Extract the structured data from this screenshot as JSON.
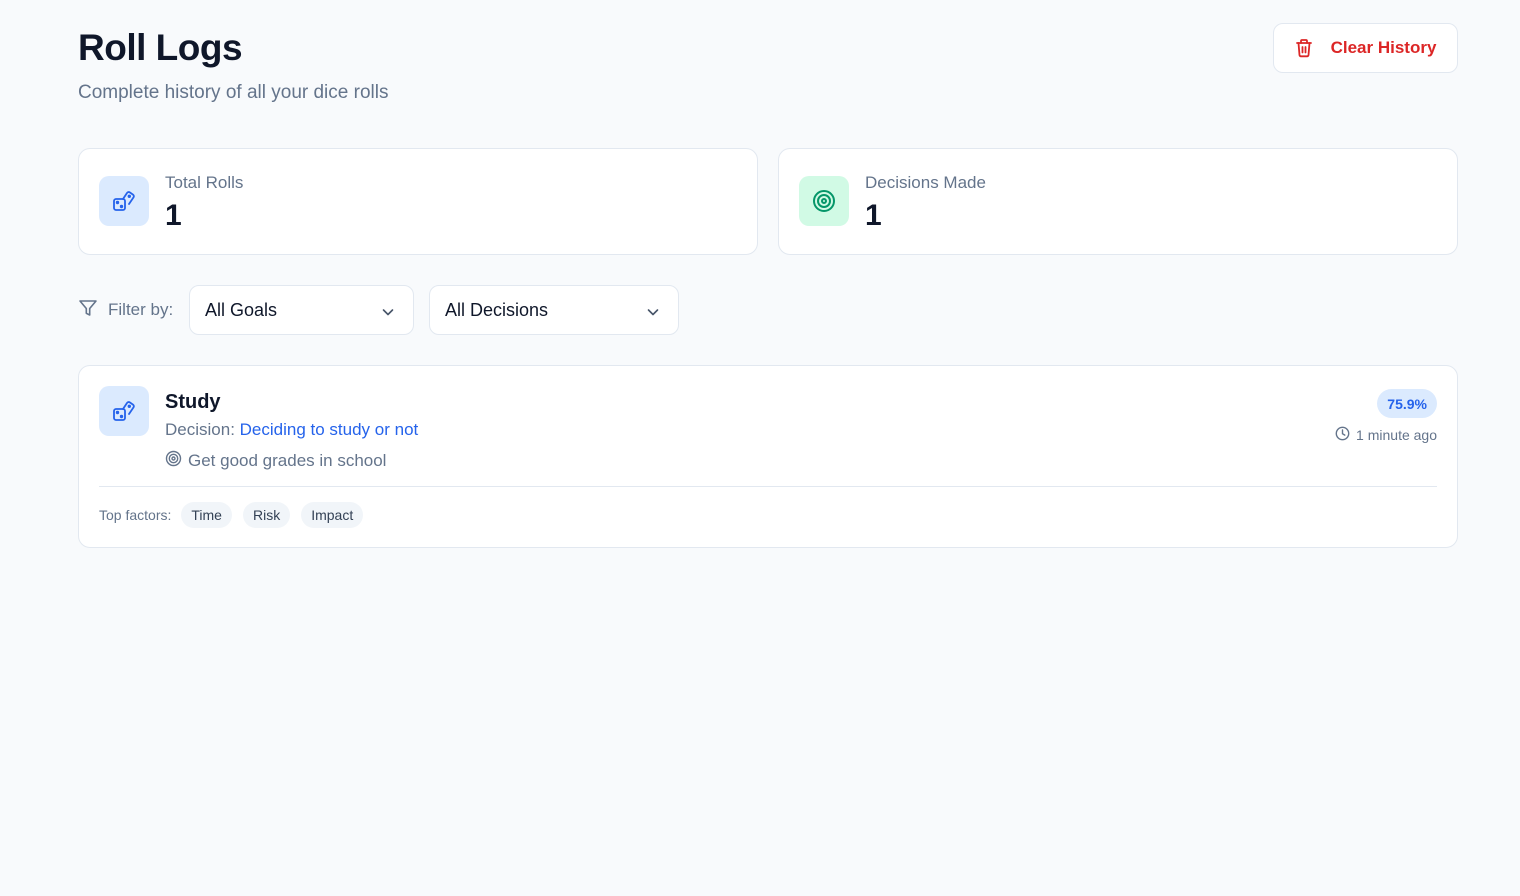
{
  "header": {
    "title": "Roll Logs",
    "subtitle": "Complete history of all your dice rolls",
    "clear_label": "Clear History"
  },
  "stats": [
    {
      "label": "Total Rolls",
      "value": "1",
      "icon": "dice-icon"
    },
    {
      "label": "Decisions Made",
      "value": "1",
      "icon": "target-icon"
    }
  ],
  "filters": {
    "label": "Filter by:",
    "goals_selected": "All Goals",
    "decisions_selected": "All Decisions"
  },
  "logs": [
    {
      "title": "Study",
      "decision_prefix": "Decision:",
      "decision": "Deciding to study or not",
      "goal": "Get good grades in school",
      "percent": "75.9%",
      "time": "1 minute ago",
      "factors_label": "Top factors:",
      "factors": [
        "Time",
        "Risk",
        "Impact"
      ]
    }
  ],
  "colors": {
    "accent_blue": "#2563eb",
    "danger_red": "#dc2626",
    "success_green": "#059669",
    "muted_text": "#64748b",
    "background": "#f8fafc"
  }
}
